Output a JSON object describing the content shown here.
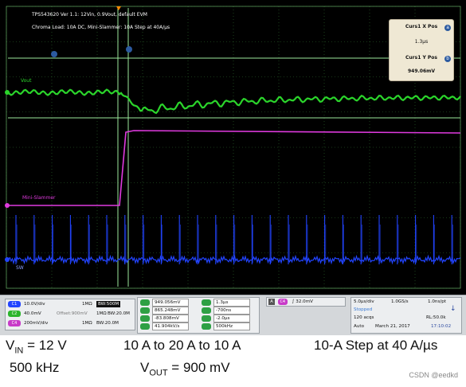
{
  "header": {
    "line1": "TPS543620 Ver 1.1: 12Vin, 0.9Vout, default EVM",
    "line2": "Chroma Load: 10A DC, Mini-Slammer: 10A Step at 40A/µs"
  },
  "traces": {
    "vout_label": "Vout",
    "slammer_label": "Mini-Slammer",
    "sw_label": "SW",
    "colors": {
      "vout": "#2bd52b",
      "slammer": "#e03adf",
      "sw": "#2244ff",
      "grid": "#3a8a3a"
    }
  },
  "cursor": {
    "a_marker": "a",
    "b_marker": "b",
    "x_title": "Curs1 X Pos",
    "x_value": "1.3µs",
    "y_title": "Curs1 Y Pos",
    "y_value": "949.06mV"
  },
  "channels": [
    {
      "id": "C1",
      "scale": "10.0V/div",
      "imp": "1MΩ",
      "bw": "BW:500M",
      "color": "#2244ff"
    },
    {
      "id": "C2",
      "scale": "40.0mV",
      "offset": "Offset:900mV",
      "imp": "1MΩ",
      "bw": "BW:20.0M",
      "color": "#2bb52b"
    },
    {
      "id": "C4",
      "scale": "200mV/div",
      "imp": "1MΩ",
      "bw": "BW:20.0M",
      "color": "#c83ac8"
    }
  ],
  "measurements": [
    {
      "v1": "949.056mV",
      "t1": "1.3µs"
    },
    {
      "v1": "865.248mV",
      "t1": "-700ns"
    },
    {
      "v1": "-83.808mV",
      "t1": "-2.0µs"
    },
    {
      "v1": "41.904kV/s",
      "t1": "500kHz"
    }
  ],
  "trigger": {
    "channel": "C4",
    "level": "32.0mV"
  },
  "acquisition": {
    "timebase": "5.0µs/div",
    "samplerate": "1.0GS/s",
    "resolution": "1.0ns/pt",
    "state": "Stopped",
    "acqs": "120 acqs",
    "record": "RL:50.0k",
    "mode": "Auto",
    "date": "March 21, 2017",
    "time": "17:10:02"
  },
  "captions": {
    "vin_text": "V",
    "vin_sub": "IN",
    "vin_rest": " = 12 V",
    "freq": "500 kHz",
    "step_range": "10 A to 20 A to 10 A",
    "vout_text": "V",
    "vout_sub": "OUT",
    "vout_rest": " = 900 mV",
    "step_rate": "10-A Step at 40 A/µs"
  },
  "watermark": "CSDN @eedkd"
}
